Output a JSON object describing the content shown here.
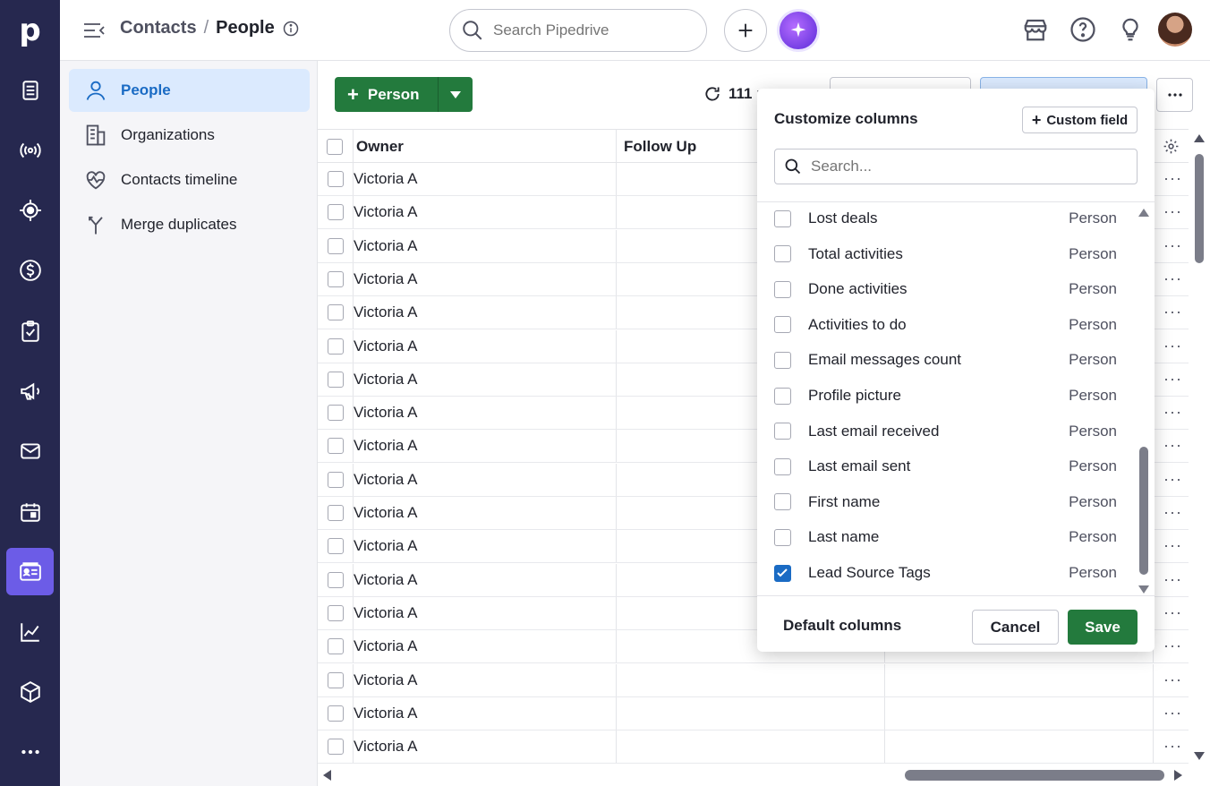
{
  "app": {
    "logo": "p"
  },
  "rail": {
    "items": [
      {
        "icon": "leads-inbox-icon"
      },
      {
        "icon": "broadcast-icon"
      },
      {
        "icon": "target-icon"
      },
      {
        "icon": "deals-dollar-icon"
      },
      {
        "icon": "tasks-icon"
      },
      {
        "icon": "campaigns-megaphone-icon"
      },
      {
        "icon": "mail-icon"
      },
      {
        "icon": "calendar-icon"
      },
      {
        "icon": "contacts-card-icon",
        "active": true
      },
      {
        "icon": "insights-chart-icon"
      },
      {
        "icon": "products-box-icon"
      },
      {
        "icon": "more-dots-icon"
      }
    ]
  },
  "header": {
    "breadcrumb_parent": "Contacts",
    "breadcrumb_sep": "/",
    "breadcrumb_current": "People",
    "search_placeholder": "Search Pipedrive"
  },
  "leftnav": {
    "items": [
      {
        "label": "People",
        "active": true
      },
      {
        "label": "Organizations"
      },
      {
        "label": "Contacts timeline"
      },
      {
        "label": "Merge duplicates"
      }
    ]
  },
  "toolbar": {
    "add_label": "Person",
    "count_label": "111 p"
  },
  "table": {
    "columns": [
      "Owner",
      "Follow Up"
    ],
    "rows": [
      "Victoria A",
      "Victoria A",
      "Victoria A",
      "Victoria A",
      "Victoria A",
      "Victoria A",
      "Victoria A",
      "Victoria A",
      "Victoria A",
      "Victoria A",
      "Victoria A",
      "Victoria A",
      "Victoria A",
      "Victoria A",
      "Victoria A",
      "Victoria A",
      "Victoria A",
      "Victoria A"
    ],
    "row_more": "···"
  },
  "customize": {
    "title": "Customize columns",
    "custom_field_label": "Custom field",
    "search_placeholder": "Search...",
    "fields": [
      {
        "label": "Lost deals",
        "type": "Person",
        "checked": false
      },
      {
        "label": "Total activities",
        "type": "Person",
        "checked": false
      },
      {
        "label": "Done activities",
        "type": "Person",
        "checked": false
      },
      {
        "label": "Activities to do",
        "type": "Person",
        "checked": false
      },
      {
        "label": "Email messages count",
        "type": "Person",
        "checked": false
      },
      {
        "label": "Profile picture",
        "type": "Person",
        "checked": false
      },
      {
        "label": "Last email received",
        "type": "Person",
        "checked": false
      },
      {
        "label": "Last email sent",
        "type": "Person",
        "checked": false
      },
      {
        "label": "First name",
        "type": "Person",
        "checked": false
      },
      {
        "label": "Last name",
        "type": "Person",
        "checked": false
      },
      {
        "label": "Lead Source Tags",
        "type": "Person",
        "checked": true
      }
    ],
    "default_columns_label": "Default columns",
    "cancel_label": "Cancel",
    "save_label": "Save"
  },
  "colors": {
    "rail_bg": "#26284f",
    "rail_active": "#6c5ce7",
    "primary_green": "#237a3d",
    "nav_active_bg": "#dbeafe",
    "link_blue": "#1a6bc4"
  }
}
